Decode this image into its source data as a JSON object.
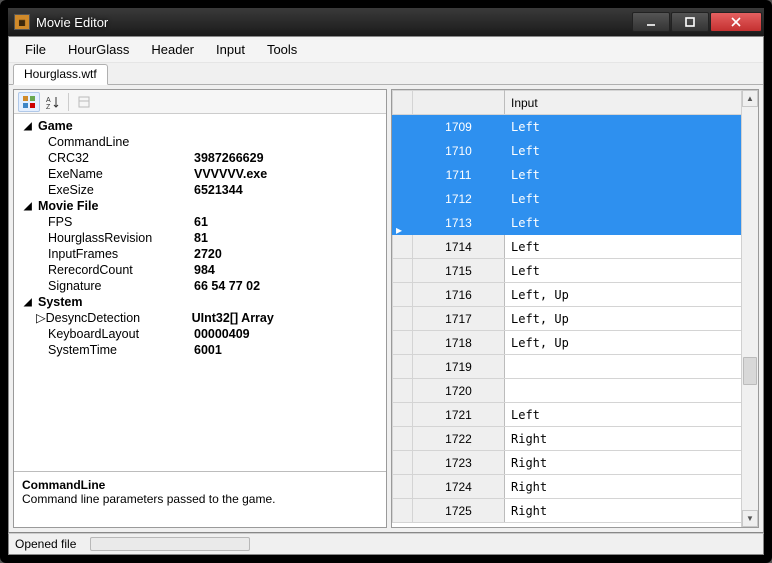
{
  "window": {
    "title": "Movie Editor"
  },
  "menu": {
    "items": [
      "File",
      "HourGlass",
      "Header",
      "Input",
      "Tools"
    ]
  },
  "tab": {
    "label": "Hourglass.wtf"
  },
  "propertygrid": {
    "categories": [
      {
        "name": "Game",
        "expanded": true,
        "rows": [
          {
            "key": "CommandLine",
            "value": ""
          },
          {
            "key": "CRC32",
            "value": "3987266629"
          },
          {
            "key": "ExeName",
            "value": "VVVVVV.exe"
          },
          {
            "key": "ExeSize",
            "value": "6521344"
          }
        ]
      },
      {
        "name": "Movie File",
        "expanded": true,
        "rows": [
          {
            "key": "FPS",
            "value": "61"
          },
          {
            "key": "HourglassRevision",
            "value": "81"
          },
          {
            "key": "InputFrames",
            "value": "2720"
          },
          {
            "key": "RerecordCount",
            "value": "984"
          },
          {
            "key": "Signature",
            "value": "66 54 77 02"
          }
        ]
      },
      {
        "name": "System",
        "expanded": true,
        "rows": [
          {
            "key": "DesyncDetection",
            "value": "UInt32[] Array",
            "expandable": true
          },
          {
            "key": "KeyboardLayout",
            "value": "00000409"
          },
          {
            "key": "SystemTime",
            "value": "6001"
          }
        ]
      }
    ],
    "description": {
      "title": "CommandLine",
      "text": "Command line parameters passed to the game."
    }
  },
  "inputgrid": {
    "header": "Input",
    "rows": [
      {
        "frame": "1709",
        "input": "Left",
        "selected": true
      },
      {
        "frame": "1710",
        "input": "Left",
        "selected": true
      },
      {
        "frame": "1711",
        "input": "Left",
        "selected": true
      },
      {
        "frame": "1712",
        "input": "Left",
        "selected": true
      },
      {
        "frame": "1713",
        "input": "Left",
        "selected": true,
        "current": true
      },
      {
        "frame": "1714",
        "input": "Left"
      },
      {
        "frame": "1715",
        "input": "Left"
      },
      {
        "frame": "1716",
        "input": "Left, Up"
      },
      {
        "frame": "1717",
        "input": "Left, Up"
      },
      {
        "frame": "1718",
        "input": "Left, Up"
      },
      {
        "frame": "1719",
        "input": ""
      },
      {
        "frame": "1720",
        "input": ""
      },
      {
        "frame": "1721",
        "input": "Left"
      },
      {
        "frame": "1722",
        "input": "Right"
      },
      {
        "frame": "1723",
        "input": "Right"
      },
      {
        "frame": "1724",
        "input": "Right"
      },
      {
        "frame": "1725",
        "input": "Right"
      }
    ]
  },
  "status": {
    "text": "Opened file"
  }
}
